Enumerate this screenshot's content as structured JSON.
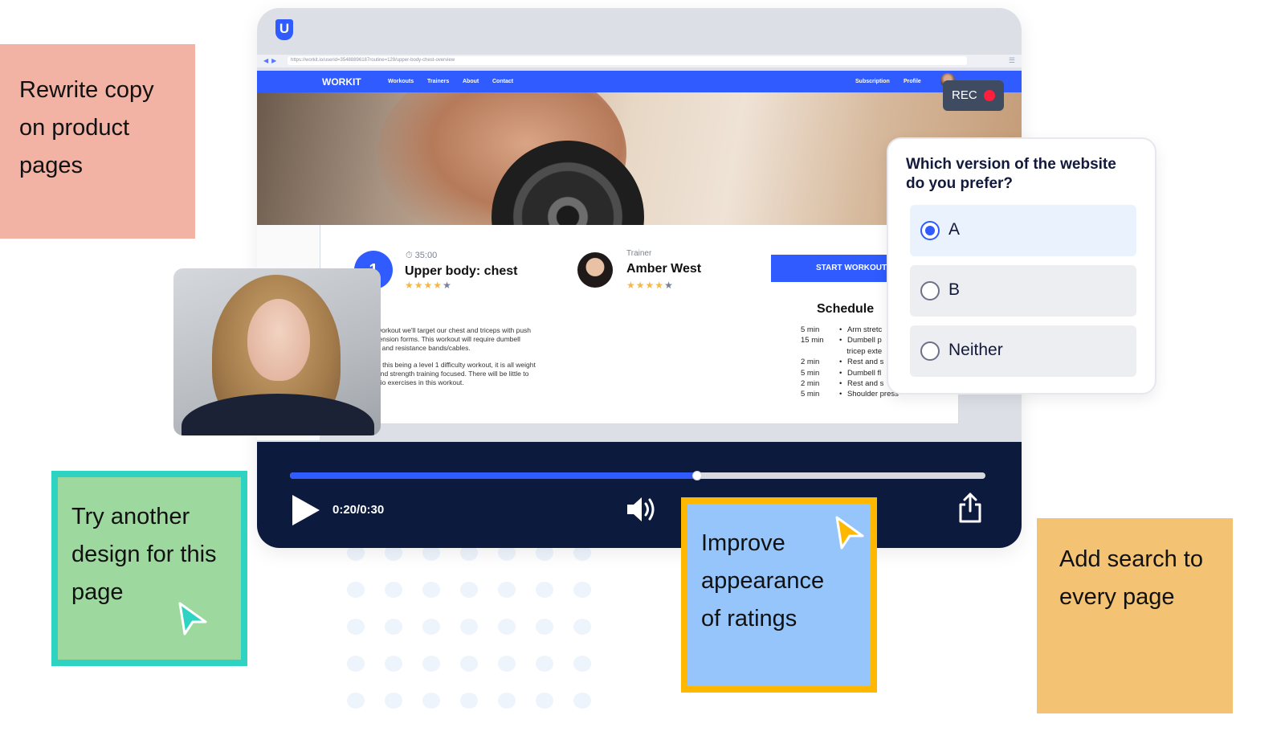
{
  "browser": {
    "url": "https://workit.io/userid=35488896187routine=129/upper-body-chest-overview"
  },
  "site": {
    "brand": "WORKIT",
    "nav_left": [
      "Workouts",
      "Trainers",
      "About",
      "Contact"
    ],
    "nav_right": [
      "Subscription",
      "Profile"
    ]
  },
  "workout": {
    "level": "1",
    "duration": "35:00",
    "title": "Upper body: chest",
    "rating_stars": 4,
    "description_1": [
      "workout we'll target our chest and triceps with push",
      "tension forms. This workout will require dumbell",
      "s and resistance bands/cables."
    ],
    "description_2": [
      "e this being a level 1 difficulty workout, it is all weight",
      "and strength training focused. There will be little to",
      "dio exercises in this workout."
    ]
  },
  "trainer": {
    "label": "Trainer",
    "name": "Amber West",
    "rating_stars": 4
  },
  "start_button": "START WORKOUT",
  "schedule": {
    "title": "Schedule",
    "rows": [
      {
        "time": "5 min",
        "item": "Arm stretc",
        "bullet": true
      },
      {
        "time": "15 min",
        "item": "Dumbell p",
        "bullet": true
      },
      {
        "time": "",
        "item": "tricep exte",
        "bullet": false
      },
      {
        "time": "2 min",
        "item": "Rest and s",
        "bullet": true
      },
      {
        "time": "5 min",
        "item": "Dumbell fl",
        "bullet": true
      },
      {
        "time": "2 min",
        "item": "Rest and s",
        "bullet": true
      },
      {
        "time": "5 min",
        "item": "Shoulder press",
        "bullet": true
      }
    ]
  },
  "player": {
    "time": "0:20/0:30",
    "progress": 0.585
  },
  "recording": {
    "label": "REC"
  },
  "survey": {
    "question": "Which version of the website do you prefer?",
    "options": [
      {
        "label": "A",
        "selected": true
      },
      {
        "label": "B",
        "selected": false
      },
      {
        "label": "Neither",
        "selected": false
      }
    ]
  },
  "notes": {
    "note1": [
      "Rewrite copy",
      "on product",
      "pages"
    ],
    "note2": [
      "Try another",
      "design for this",
      "page"
    ],
    "note3": [
      "Improve",
      "appearance",
      "of ratings"
    ],
    "note4": [
      "Add search to",
      "every page"
    ]
  },
  "colors": {
    "primary": "#2f5bff",
    "player_bg": "#0c1a3e",
    "note_pink": "#f2b2a4",
    "note_green": "#9dd89e",
    "note_blue": "#95c5fb",
    "note_orange": "#f3c273",
    "rec_red": "#ff1f3d"
  },
  "icons": {
    "app_logo": "u-logo-icon",
    "play": "play-icon",
    "volume": "volume-icon",
    "share": "share-icon",
    "timer": "stopwatch-icon",
    "cursor": "mouse-pointer-icon"
  }
}
